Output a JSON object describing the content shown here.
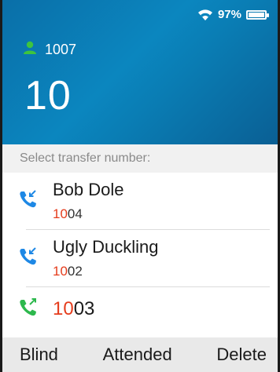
{
  "status": {
    "battery_text": "97%",
    "battery_level": 0.97
  },
  "account": {
    "number": "1007"
  },
  "dialed": "10",
  "prompt": "Select transfer number:",
  "contacts": [
    {
      "name": "Bob Dole",
      "number_match": "10",
      "number_rest": "04",
      "icon": "incoming-call-icon",
      "icon_color": "#1e88e5"
    },
    {
      "name": "Ugly Duckling",
      "number_match": "10",
      "number_rest": "02",
      "icon": "incoming-call-icon",
      "icon_color": "#1e88e5"
    },
    {
      "name": "",
      "number_match": "10",
      "number_rest": "03",
      "icon": "outgoing-call-icon",
      "icon_color": "#2db84d"
    }
  ],
  "softkeys": {
    "blind": "Blind",
    "attended": "Attended",
    "delete": "Delete"
  },
  "colors": {
    "header": "#0b86bf",
    "match": "#e53c1c",
    "account_icon": "#3ec43e"
  }
}
